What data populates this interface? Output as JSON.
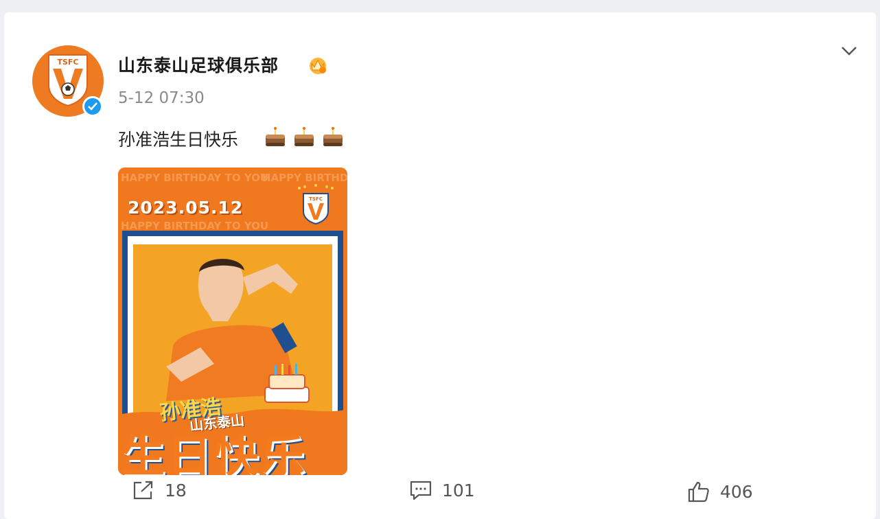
{
  "post": {
    "author": "山东泰山足球俱乐部",
    "time": "5-12 07:30",
    "text": "孙准浩生日快乐",
    "emojis": [
      "birthday-cake-icon",
      "birthday-cake-icon",
      "birthday-cake-icon"
    ],
    "verified": true,
    "badge": "crown-icon"
  },
  "avatar": {
    "crest_text": "TSFC"
  },
  "poster": {
    "date": "2023.05.12",
    "pattern_text": "HAPPY BIRTHDAY TO YOU",
    "crest_text": "TSFC",
    "player_name": "孙准浩",
    "club": "山东泰山",
    "title": "生日快乐"
  },
  "actions": {
    "share_count": "18",
    "comment_count": "101",
    "like_count": "406"
  },
  "colors": {
    "brand_orange": "#f0781f",
    "accent_blue": "#1f4f8f",
    "verified_blue": "#1d9bf0"
  }
}
